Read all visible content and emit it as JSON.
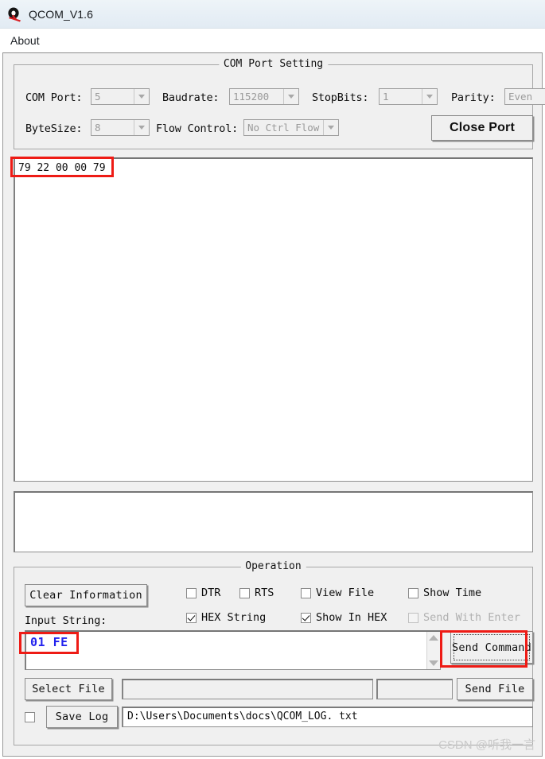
{
  "window": {
    "title": "QCOM_V1.6",
    "icon": "q-logo-icon"
  },
  "menubar": {
    "items": [
      {
        "label": "About"
      }
    ]
  },
  "com_port_setting": {
    "group_title": "COM Port Setting",
    "fields": [
      {
        "label": "COM Port:",
        "value": "5"
      },
      {
        "label": "Baudrate:",
        "value": "115200"
      },
      {
        "label": "StopBits:",
        "value": "1"
      },
      {
        "label": "Parity:",
        "value": "Even"
      },
      {
        "label": "ByteSize:",
        "value": "8"
      },
      {
        "label": "Flow Control:",
        "value": "No Ctrl Flow"
      }
    ],
    "close_port_button": "Close Port"
  },
  "receive_panel": {
    "text": "79 22 00 00 79"
  },
  "secondary_panel": {
    "text": ""
  },
  "operation": {
    "group_title": "Operation",
    "clear_information_button": "Clear Information",
    "input_string_label": "Input String:",
    "checkboxes": [
      {
        "label": "DTR",
        "checked": false,
        "disabled": false
      },
      {
        "label": "RTS",
        "checked": false,
        "disabled": false
      },
      {
        "label": "View File",
        "checked": false,
        "disabled": false
      },
      {
        "label": "Show Time",
        "checked": false,
        "disabled": false
      },
      {
        "label": "HEX String",
        "checked": true,
        "disabled": false
      },
      {
        "label": "Show In HEX",
        "checked": true,
        "disabled": false
      },
      {
        "label": "Send With Enter",
        "checked": false,
        "disabled": true
      }
    ],
    "input_value": "01 FE",
    "send_command_button": "Send Command",
    "select_file_button": "Select File",
    "file_path_value": "",
    "file_progress_value": "",
    "send_file_button": "Send File",
    "save_log_checked": false,
    "save_log_button": "Save Log",
    "log_path_value": "D:\\Users\\Documents\\docs\\QCOM_LOG. txt"
  },
  "watermark": {
    "text": "CSDN @听我一言"
  },
  "colors": {
    "annotation": "#ee1b15",
    "input_text": "#2222ee",
    "face": "#f0f0f0"
  }
}
